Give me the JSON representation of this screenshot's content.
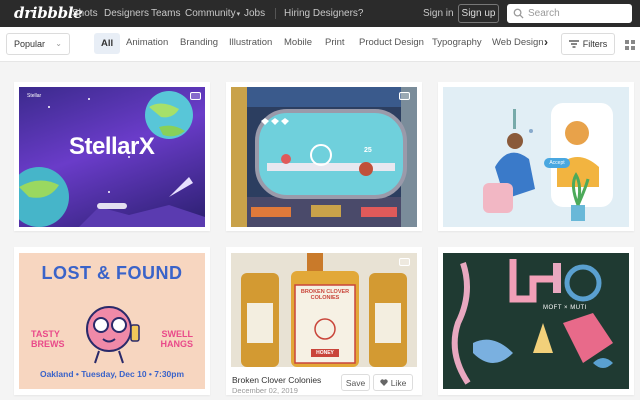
{
  "brand": {
    "logo": "dribbble"
  },
  "nav": {
    "links": [
      "Shots",
      "Designers",
      "Teams",
      "Community",
      "Jobs"
    ],
    "hiring": "Hiring Designers?",
    "sign_in": "Sign in",
    "sign_up": "Sign up",
    "search_placeholder": "Search"
  },
  "filters": {
    "sort_selected": "Popular",
    "categories": [
      "All",
      "Animation",
      "Branding",
      "Illustration",
      "Mobile",
      "Print",
      "Product Design",
      "Typography",
      "Web Design"
    ],
    "active_category": "All",
    "filters_label": "Filters"
  },
  "shots": [
    {
      "name": "stellarx",
      "headline": "StellarX",
      "animated": true
    },
    {
      "name": "space-runner-game",
      "score": "25",
      "animated": true
    },
    {
      "name": "accept-illustration",
      "button_text": "Accept",
      "animated": false
    },
    {
      "name": "lost-and-found-poster",
      "headline_1": "LOST & FOUND",
      "left_text": "TASTY BREWS",
      "right_text": "SWELL HANGS",
      "footer": "Oakland • Tuesday, Dec 10 • 7:30pm",
      "animated": false
    },
    {
      "name": "broken-clover-colonies",
      "title": "Broken Clover Colonies",
      "date": "December 02, 2019",
      "label_text": "BROKEN CLOVER COLONIES",
      "honey": "HONEY",
      "animated": true
    },
    {
      "name": "moft-muti-pattern",
      "label": "MOFT × MUTI",
      "animated": false
    }
  ],
  "hover_actions": {
    "save": "Save",
    "like": "Like"
  },
  "colors": {
    "nav_bg": "#2b2b2b",
    "page_bg": "#f4f4f4",
    "active_tab_bg": "#e8eef6"
  }
}
